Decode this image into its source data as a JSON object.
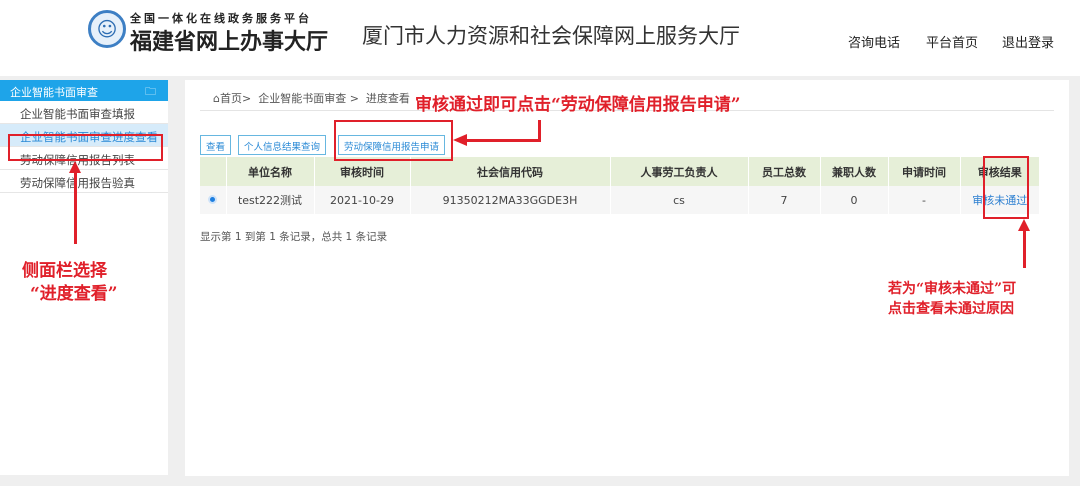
{
  "header": {
    "logo_sub": "全国一体化在线政务服务平台",
    "logo_main": "福建省网上办事大厅",
    "site_title": "厦门市人力资源和社会保障网上服务大厅",
    "nav": [
      "咨询电话",
      "平台首页",
      "退出登录"
    ]
  },
  "sidebar": {
    "title": "企业智能书面审查",
    "items": [
      "企业智能书面审查填报",
      "企业智能书面审查进度查看",
      "劳动保障信用报告列表",
      "劳动保障信用报告验真"
    ]
  },
  "breadcrumb": [
    "首页>",
    "企业智能书面审查 >",
    "进度查看"
  ],
  "toolbar": [
    "查看",
    "个人信息结果查询",
    "劳动保障信用报告申请"
  ],
  "table": {
    "headers": [
      "",
      "单位名称",
      "审核时间",
      "社会信用代码",
      "人事劳工负责人",
      "员工总数",
      "兼职人数",
      "申请时间",
      "审核结果"
    ],
    "rows": [
      [
        "test222测试",
        "2021-10-29",
        "91350212MA33GGDE3H",
        "cs",
        "7",
        "0",
        "-",
        "审核未通过"
      ]
    ]
  },
  "pager": "显示第 1 到第 1 条记录，总共 1 条记录",
  "annotations": {
    "top": "审核通过即可点击“劳动保障信用报告申请”",
    "left1": "侧面栏选择",
    "left2": "“进度查看”",
    "right1": "若为“审核未通过”可",
    "right2": "点击查看未通过原因"
  }
}
